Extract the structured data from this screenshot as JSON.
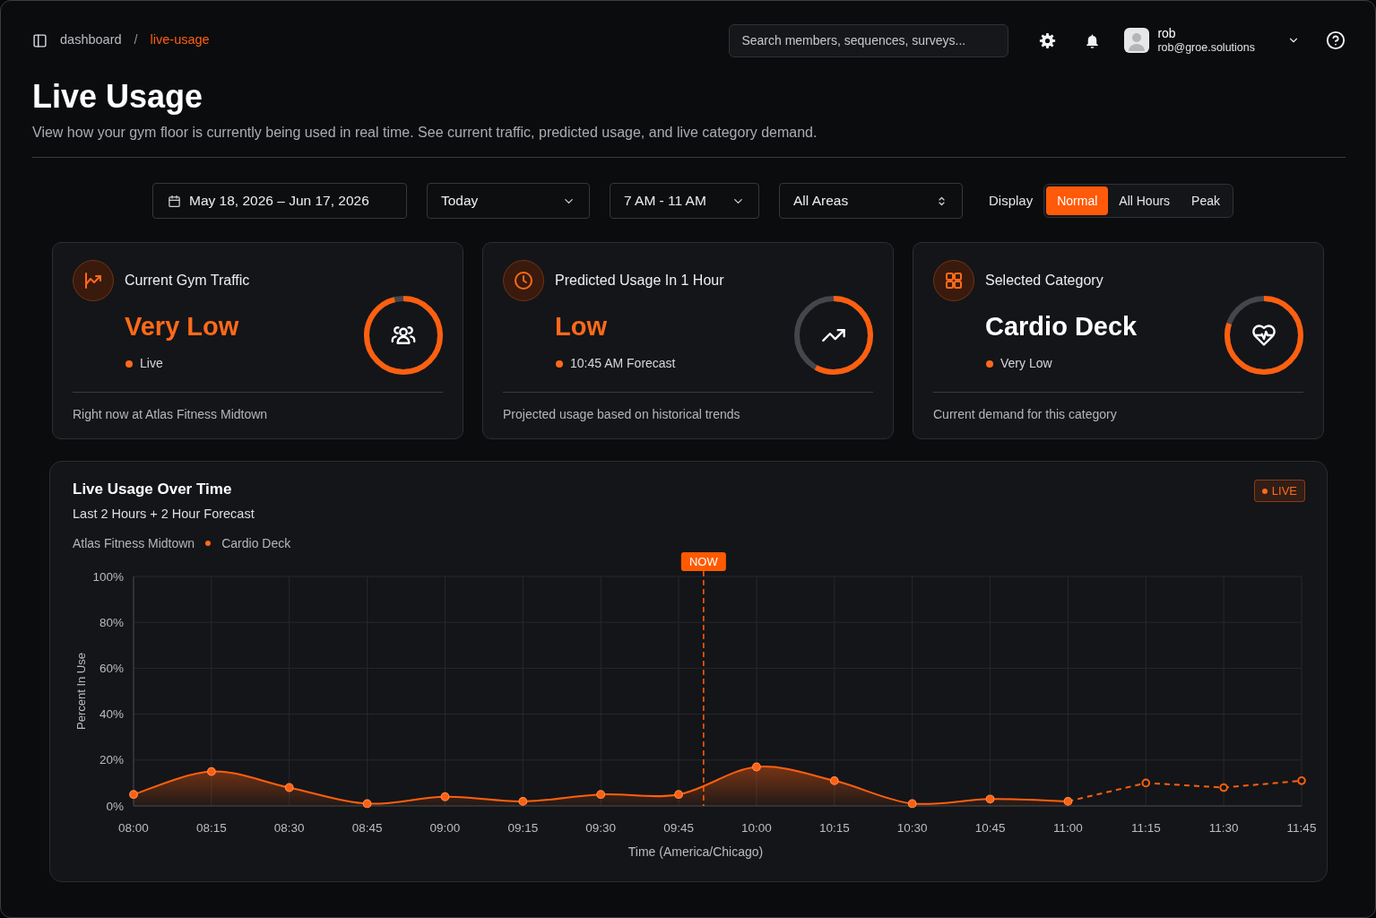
{
  "breadcrumb": {
    "separator": "/",
    "items": [
      {
        "label": "dashboard",
        "selected": false
      },
      {
        "label": "live-usage",
        "selected": true
      }
    ]
  },
  "search": {
    "placeholder": "Search members, sequences, surveys..."
  },
  "user": {
    "name": "rob",
    "email": "rob@groe.solutions"
  },
  "page": {
    "title": "Live Usage",
    "description": "View how your gym floor is currently being used in real time. See current traffic, predicted usage, and live category demand."
  },
  "filters": [
    {
      "kind": "date_range",
      "value": "May 18, 2026 – Jun 17, 2026"
    },
    {
      "kind": "dropdown",
      "value": "Today"
    },
    {
      "kind": "dropdown",
      "value": "7 AM - 11 AM"
    },
    {
      "kind": "select",
      "value": "All Areas"
    }
  ],
  "display": {
    "label": "Display",
    "options": [
      {
        "label": "Normal",
        "selected": true
      },
      {
        "label": "All Hours",
        "selected": false
      },
      {
        "label": "Peak",
        "selected": false
      }
    ]
  },
  "cards": [
    {
      "kind": "level",
      "title": "Current Gym Traffic",
      "value": "Very Low",
      "status": "Live",
      "level": 0.96,
      "footer": "Right now at Atlas Fitness Midtown"
    },
    {
      "kind": "level",
      "title": "Predicted Usage In 1 Hour",
      "value": "Low",
      "status": "10:45 AM Forecast",
      "level": 0.58,
      "footer": "Projected usage based on historical trends"
    },
    {
      "kind": "category",
      "title": "Selected Category",
      "value": "Cardio Deck",
      "status": "Very Low",
      "level": 0.8,
      "footer": "Current demand for this category"
    }
  ],
  "usage_panel": {
    "title": "Live Usage Over Time",
    "subtitle": "Last 2 Hours + 2 Hour Forecast",
    "location": "Atlas Fitness Midtown",
    "category": "Cardio Deck",
    "badge": "LIVE",
    "chart_data": {
      "type": "line",
      "xlabel": "Time (America/Chicago)",
      "ylabel": "Percent In Use",
      "x": [
        8,
        8.25,
        8.5,
        8.75,
        9,
        9.25,
        9.5,
        9.75,
        10,
        10.25,
        10.5,
        10.75,
        11,
        11.25,
        11.5,
        11.75
      ],
      "xlim": [
        8,
        11.75
      ],
      "xticks": [
        {
          "value": 8,
          "label": "08:00"
        },
        {
          "value": 8.25,
          "label": "08:15"
        },
        {
          "value": 8.5,
          "label": "08:30"
        },
        {
          "value": 8.75,
          "label": "08:45"
        },
        {
          "value": 9,
          "label": "09:00"
        },
        {
          "value": 9.25,
          "label": "09:15"
        },
        {
          "value": 9.5,
          "label": "09:30"
        },
        {
          "value": 9.75,
          "label": "09:45"
        },
        {
          "value": 10,
          "label": "10:00"
        },
        {
          "value": 10.25,
          "label": "10:15"
        },
        {
          "value": 10.5,
          "label": "10:30"
        },
        {
          "value": 10.75,
          "label": "10:45"
        },
        {
          "value": 11,
          "label": "11:00"
        },
        {
          "value": 11.25,
          "label": "11:15"
        },
        {
          "value": 11.5,
          "label": "11:30"
        },
        {
          "value": 11.75,
          "label": "11:45"
        }
      ],
      "ylim": [
        0,
        100
      ],
      "yticks": [
        {
          "value": 0,
          "label": "0%"
        },
        {
          "value": 20,
          "label": "20%"
        },
        {
          "value": 40,
          "label": "40%"
        },
        {
          "value": 60,
          "label": "60%"
        },
        {
          "value": 80,
          "label": "80%"
        },
        {
          "value": 100,
          "label": "100%"
        }
      ],
      "grid": true,
      "series": [
        {
          "type": "area",
          "color": "#ff5f0f",
          "marker": "circle",
          "values": [
            5,
            15,
            8,
            1,
            4,
            2,
            5,
            5,
            17,
            11,
            1,
            3,
            2,
            null,
            null,
            null
          ]
        },
        {
          "type": "line",
          "color": "#ff5f0f",
          "marker": "open_circle",
          "line_style": "dashed",
          "values": [
            null,
            null,
            null,
            null,
            null,
            null,
            null,
            null,
            null,
            null,
            null,
            null,
            2,
            10,
            8,
            11
          ]
        }
      ],
      "ref_lines": [
        {
          "axis": "x",
          "value": 9.83,
          "label": "NOW",
          "color": "#ff5a00",
          "line_style": "dashed"
        }
      ]
    }
  }
}
